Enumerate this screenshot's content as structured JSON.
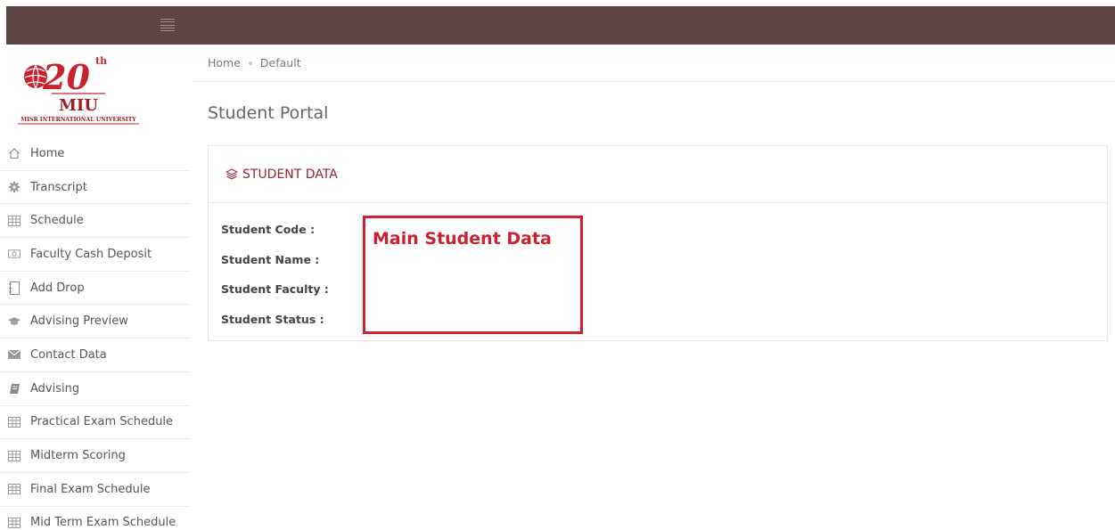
{
  "logo": {
    "anniversary_number": "20",
    "anniversary_suffix": "th",
    "acronym": "MIU",
    "university_name": "MISR INTERNATIONAL UNIVERSITY"
  },
  "breadcrumb": {
    "home": "Home",
    "current": "Default"
  },
  "page": {
    "title": "Student Portal"
  },
  "panel": {
    "title": "STUDENT DATA",
    "fields": [
      {
        "label": "Student Code :"
      },
      {
        "label": "Student Name :"
      },
      {
        "label": "Student Faculty :"
      },
      {
        "label": "Student Status :"
      }
    ]
  },
  "annotation": {
    "text": "Main Student Data",
    "color": "#d22030"
  },
  "sidebar": {
    "items": [
      {
        "label": "Home",
        "icon": "home-icon"
      },
      {
        "label": "Transcript",
        "icon": "gear-icon"
      },
      {
        "label": "Schedule",
        "icon": "table-icon"
      },
      {
        "label": "Faculty Cash Deposit",
        "icon": "money-icon"
      },
      {
        "label": "Add Drop",
        "icon": "book-icon"
      },
      {
        "label": "Advising Preview",
        "icon": "graduation-cap-icon"
      },
      {
        "label": "Contact Data",
        "icon": "envelope-icon"
      },
      {
        "label": "Advising",
        "icon": "notebook-icon"
      },
      {
        "label": "Practical Exam Schedule",
        "icon": "table-icon"
      },
      {
        "label": "Midterm Scoring",
        "icon": "table-icon"
      },
      {
        "label": "Final Exam Schedule",
        "icon": "table-icon"
      },
      {
        "label": "Mid Term Exam Schedule",
        "icon": "table-icon"
      }
    ]
  },
  "colors": {
    "topbar": "#5b4545",
    "accent": "#9b2335",
    "annotation": "#d22030"
  }
}
